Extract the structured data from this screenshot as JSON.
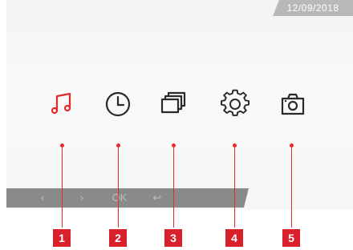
{
  "header": {
    "date": "12/09/2018"
  },
  "menu": {
    "items": [
      {
        "icon": "music-note-icon",
        "selected": true
      },
      {
        "icon": "clock-icon",
        "selected": false
      },
      {
        "icon": "gallery-icon",
        "selected": false
      },
      {
        "icon": "gear-icon",
        "selected": false
      },
      {
        "icon": "camera-icon",
        "selected": false
      }
    ]
  },
  "navbar": {
    "left": "‹",
    "right": "›",
    "ok": "OK",
    "back": "↩"
  },
  "callouts": [
    "1",
    "2",
    "3",
    "4",
    "5"
  ],
  "colors": {
    "accent": "#e32b2b",
    "icon": "#2a2a2a",
    "navbar": "#8a8a8a"
  }
}
